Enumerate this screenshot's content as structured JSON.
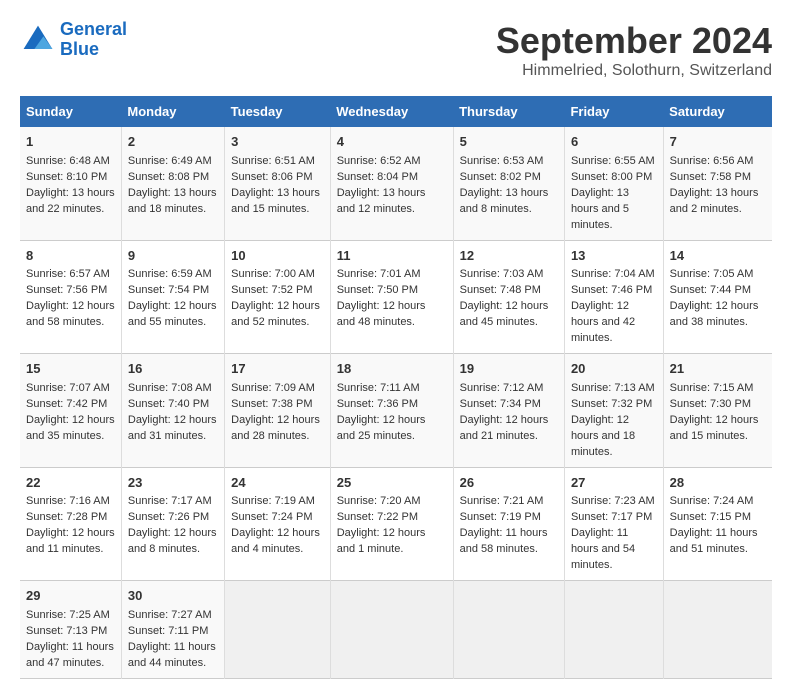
{
  "header": {
    "logo_line1": "General",
    "logo_line2": "Blue",
    "main_title": "September 2024",
    "subtitle": "Himmelried, Solothurn, Switzerland"
  },
  "columns": [
    "Sunday",
    "Monday",
    "Tuesday",
    "Wednesday",
    "Thursday",
    "Friday",
    "Saturday"
  ],
  "weeks": [
    [
      {
        "day": "1",
        "sunrise": "Sunrise: 6:48 AM",
        "sunset": "Sunset: 8:10 PM",
        "daylight": "Daylight: 13 hours and 22 minutes."
      },
      {
        "day": "2",
        "sunrise": "Sunrise: 6:49 AM",
        "sunset": "Sunset: 8:08 PM",
        "daylight": "Daylight: 13 hours and 18 minutes."
      },
      {
        "day": "3",
        "sunrise": "Sunrise: 6:51 AM",
        "sunset": "Sunset: 8:06 PM",
        "daylight": "Daylight: 13 hours and 15 minutes."
      },
      {
        "day": "4",
        "sunrise": "Sunrise: 6:52 AM",
        "sunset": "Sunset: 8:04 PM",
        "daylight": "Daylight: 13 hours and 12 minutes."
      },
      {
        "day": "5",
        "sunrise": "Sunrise: 6:53 AM",
        "sunset": "Sunset: 8:02 PM",
        "daylight": "Daylight: 13 hours and 8 minutes."
      },
      {
        "day": "6",
        "sunrise": "Sunrise: 6:55 AM",
        "sunset": "Sunset: 8:00 PM",
        "daylight": "Daylight: 13 hours and 5 minutes."
      },
      {
        "day": "7",
        "sunrise": "Sunrise: 6:56 AM",
        "sunset": "Sunset: 7:58 PM",
        "daylight": "Daylight: 13 hours and 2 minutes."
      }
    ],
    [
      {
        "day": "8",
        "sunrise": "Sunrise: 6:57 AM",
        "sunset": "Sunset: 7:56 PM",
        "daylight": "Daylight: 12 hours and 58 minutes."
      },
      {
        "day": "9",
        "sunrise": "Sunrise: 6:59 AM",
        "sunset": "Sunset: 7:54 PM",
        "daylight": "Daylight: 12 hours and 55 minutes."
      },
      {
        "day": "10",
        "sunrise": "Sunrise: 7:00 AM",
        "sunset": "Sunset: 7:52 PM",
        "daylight": "Daylight: 12 hours and 52 minutes."
      },
      {
        "day": "11",
        "sunrise": "Sunrise: 7:01 AM",
        "sunset": "Sunset: 7:50 PM",
        "daylight": "Daylight: 12 hours and 48 minutes."
      },
      {
        "day": "12",
        "sunrise": "Sunrise: 7:03 AM",
        "sunset": "Sunset: 7:48 PM",
        "daylight": "Daylight: 12 hours and 45 minutes."
      },
      {
        "day": "13",
        "sunrise": "Sunrise: 7:04 AM",
        "sunset": "Sunset: 7:46 PM",
        "daylight": "Daylight: 12 hours and 42 minutes."
      },
      {
        "day": "14",
        "sunrise": "Sunrise: 7:05 AM",
        "sunset": "Sunset: 7:44 PM",
        "daylight": "Daylight: 12 hours and 38 minutes."
      }
    ],
    [
      {
        "day": "15",
        "sunrise": "Sunrise: 7:07 AM",
        "sunset": "Sunset: 7:42 PM",
        "daylight": "Daylight: 12 hours and 35 minutes."
      },
      {
        "day": "16",
        "sunrise": "Sunrise: 7:08 AM",
        "sunset": "Sunset: 7:40 PM",
        "daylight": "Daylight: 12 hours and 31 minutes."
      },
      {
        "day": "17",
        "sunrise": "Sunrise: 7:09 AM",
        "sunset": "Sunset: 7:38 PM",
        "daylight": "Daylight: 12 hours and 28 minutes."
      },
      {
        "day": "18",
        "sunrise": "Sunrise: 7:11 AM",
        "sunset": "Sunset: 7:36 PM",
        "daylight": "Daylight: 12 hours and 25 minutes."
      },
      {
        "day": "19",
        "sunrise": "Sunrise: 7:12 AM",
        "sunset": "Sunset: 7:34 PM",
        "daylight": "Daylight: 12 hours and 21 minutes."
      },
      {
        "day": "20",
        "sunrise": "Sunrise: 7:13 AM",
        "sunset": "Sunset: 7:32 PM",
        "daylight": "Daylight: 12 hours and 18 minutes."
      },
      {
        "day": "21",
        "sunrise": "Sunrise: 7:15 AM",
        "sunset": "Sunset: 7:30 PM",
        "daylight": "Daylight: 12 hours and 15 minutes."
      }
    ],
    [
      {
        "day": "22",
        "sunrise": "Sunrise: 7:16 AM",
        "sunset": "Sunset: 7:28 PM",
        "daylight": "Daylight: 12 hours and 11 minutes."
      },
      {
        "day": "23",
        "sunrise": "Sunrise: 7:17 AM",
        "sunset": "Sunset: 7:26 PM",
        "daylight": "Daylight: 12 hours and 8 minutes."
      },
      {
        "day": "24",
        "sunrise": "Sunrise: 7:19 AM",
        "sunset": "Sunset: 7:24 PM",
        "daylight": "Daylight: 12 hours and 4 minutes."
      },
      {
        "day": "25",
        "sunrise": "Sunrise: 7:20 AM",
        "sunset": "Sunset: 7:22 PM",
        "daylight": "Daylight: 12 hours and 1 minute."
      },
      {
        "day": "26",
        "sunrise": "Sunrise: 7:21 AM",
        "sunset": "Sunset: 7:19 PM",
        "daylight": "Daylight: 11 hours and 58 minutes."
      },
      {
        "day": "27",
        "sunrise": "Sunrise: 7:23 AM",
        "sunset": "Sunset: 7:17 PM",
        "daylight": "Daylight: 11 hours and 54 minutes."
      },
      {
        "day": "28",
        "sunrise": "Sunrise: 7:24 AM",
        "sunset": "Sunset: 7:15 PM",
        "daylight": "Daylight: 11 hours and 51 minutes."
      }
    ],
    [
      {
        "day": "29",
        "sunrise": "Sunrise: 7:25 AM",
        "sunset": "Sunset: 7:13 PM",
        "daylight": "Daylight: 11 hours and 47 minutes."
      },
      {
        "day": "30",
        "sunrise": "Sunrise: 7:27 AM",
        "sunset": "Sunset: 7:11 PM",
        "daylight": "Daylight: 11 hours and 44 minutes."
      },
      null,
      null,
      null,
      null,
      null
    ]
  ]
}
